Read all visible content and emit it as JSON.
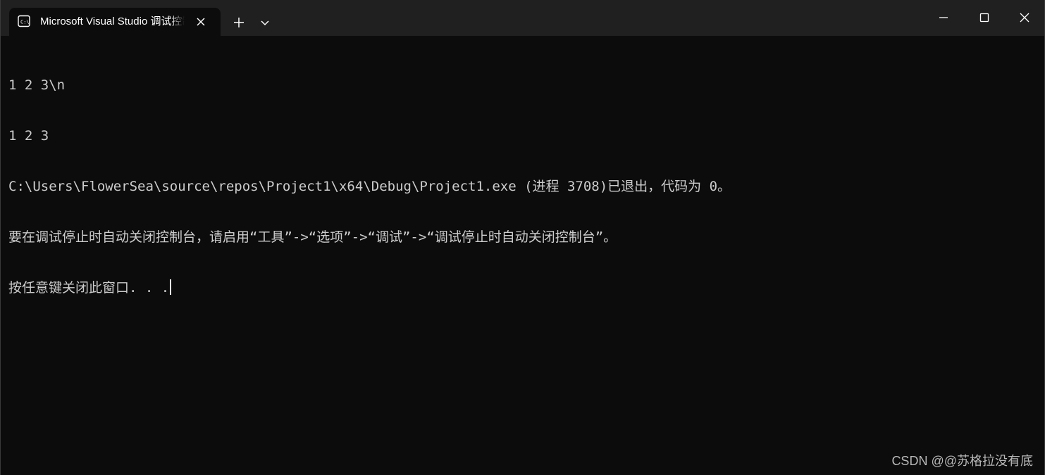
{
  "window": {
    "tab_title": "Microsoft Visual Studio 调试控制台",
    "tab_icon": "console-icon",
    "close_tab_icon": "close-icon",
    "new_tab_icon": "plus-icon",
    "dropdown_icon": "chevron-down-icon",
    "minimize_icon": "minimize-icon",
    "maximize_icon": "maximize-icon",
    "close_window_icon": "close-icon"
  },
  "console": {
    "lines": [
      "1 2 3\\n",
      "1 2 3",
      "C:\\Users\\FlowerSea\\source\\repos\\Project1\\x64\\Debug\\Project1.exe (进程 3708)已退出，代码为 0。",
      "要在调试停止时自动关闭控制台，请启用“工具”->“选项”->“调试”->“调试停止时自动关闭控制台”。",
      "按任意键关闭此窗口. . ."
    ]
  },
  "watermark": "CSDN @@苏格拉没有底",
  "colors": {
    "background": "#0c0c0c",
    "titlebar": "#202020",
    "text": "#cccccc"
  }
}
